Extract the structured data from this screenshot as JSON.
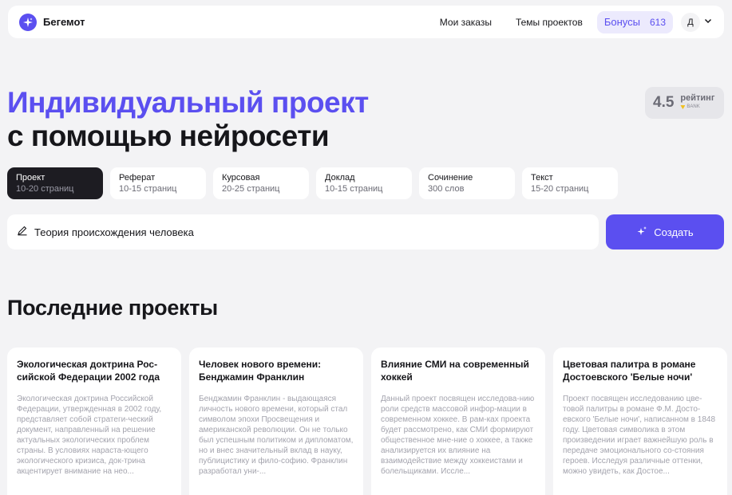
{
  "header": {
    "logo_text": "Бегемот",
    "nav": [
      {
        "label": "Мои заказы"
      },
      {
        "label": "Темы проектов"
      }
    ],
    "bonus": {
      "label": "Бонусы",
      "count": "613"
    },
    "avatar": {
      "initial": "Д"
    }
  },
  "hero": {
    "line1": "Индивидуальный проект",
    "line2": "с помощью нейросети"
  },
  "rating": {
    "value": "4.5",
    "label": "рейтинг",
    "bank": "BANK"
  },
  "types": [
    {
      "name": "Проект",
      "meta": "10-20 страниц",
      "active": true
    },
    {
      "name": "Реферат",
      "meta": "10-15 страниц",
      "active": false
    },
    {
      "name": "Курсовая",
      "meta": "20-25 страниц",
      "active": false
    },
    {
      "name": "Доклад",
      "meta": "10-15 страниц",
      "active": false
    },
    {
      "name": "Сочинение",
      "meta": "300 слов",
      "active": false
    },
    {
      "name": "Текст",
      "meta": "15-20 страниц",
      "active": false
    }
  ],
  "topic": {
    "value": "Теория происхождения человека",
    "create_label": "Создать"
  },
  "recent": {
    "title": "Последние проекты",
    "cards": [
      {
        "title": "Экологическая доктрина Рос-сийской Федерации 2002 года",
        "desc": "Экологическая доктрина Российской Федерации, утвержденная в 2002 году, представляет собой стратеги-ческий документ, направленный на решение актуальных экологических проблем страны. В условиях нараста-ющего экологического кризиса, док-трина акцентирует внимание на нео..."
      },
      {
        "title": "Человек нового времени: Бенджамин Франклин",
        "desc": "Бенджамин Франклин - выдающаяся личность нового времени, который стал символом эпохи Просвещения и американской революции. Он не только был успешным политиком и дипломатом, но и внес значительный вклад в науку, публицистику и фило-софию. Франклин разработал уни-..."
      },
      {
        "title": "Влияние СМИ на современный хоккей",
        "desc": "Данный проект посвящен исследова-нию роли средств массовой инфор-мации в современном хоккее. В рам-ках проекта будет рассмотрено, как СМИ формируют общественное мне-ние о хоккее, а также анализируется их влияние на взаимодействие между хоккеистами и болельщиками. Иссле..."
      },
      {
        "title": "Цветовая палитра в романе Достоевского 'Белые ночи'",
        "desc": "Проект посвящен исследованию цве-товой палитры в романе Ф.М. Досто-евского 'Белые ночи', написанном в 1848 году. Цветовая символика в этом произведении играет важнейшую роль в передаче эмоционального со-стояния героев. Исследуя различные оттенки, можно увидеть, как Достое..."
      }
    ]
  },
  "colors": {
    "accent": "#5b4ff0",
    "background": "#f3f3f5",
    "dark": "#1d1c22"
  }
}
